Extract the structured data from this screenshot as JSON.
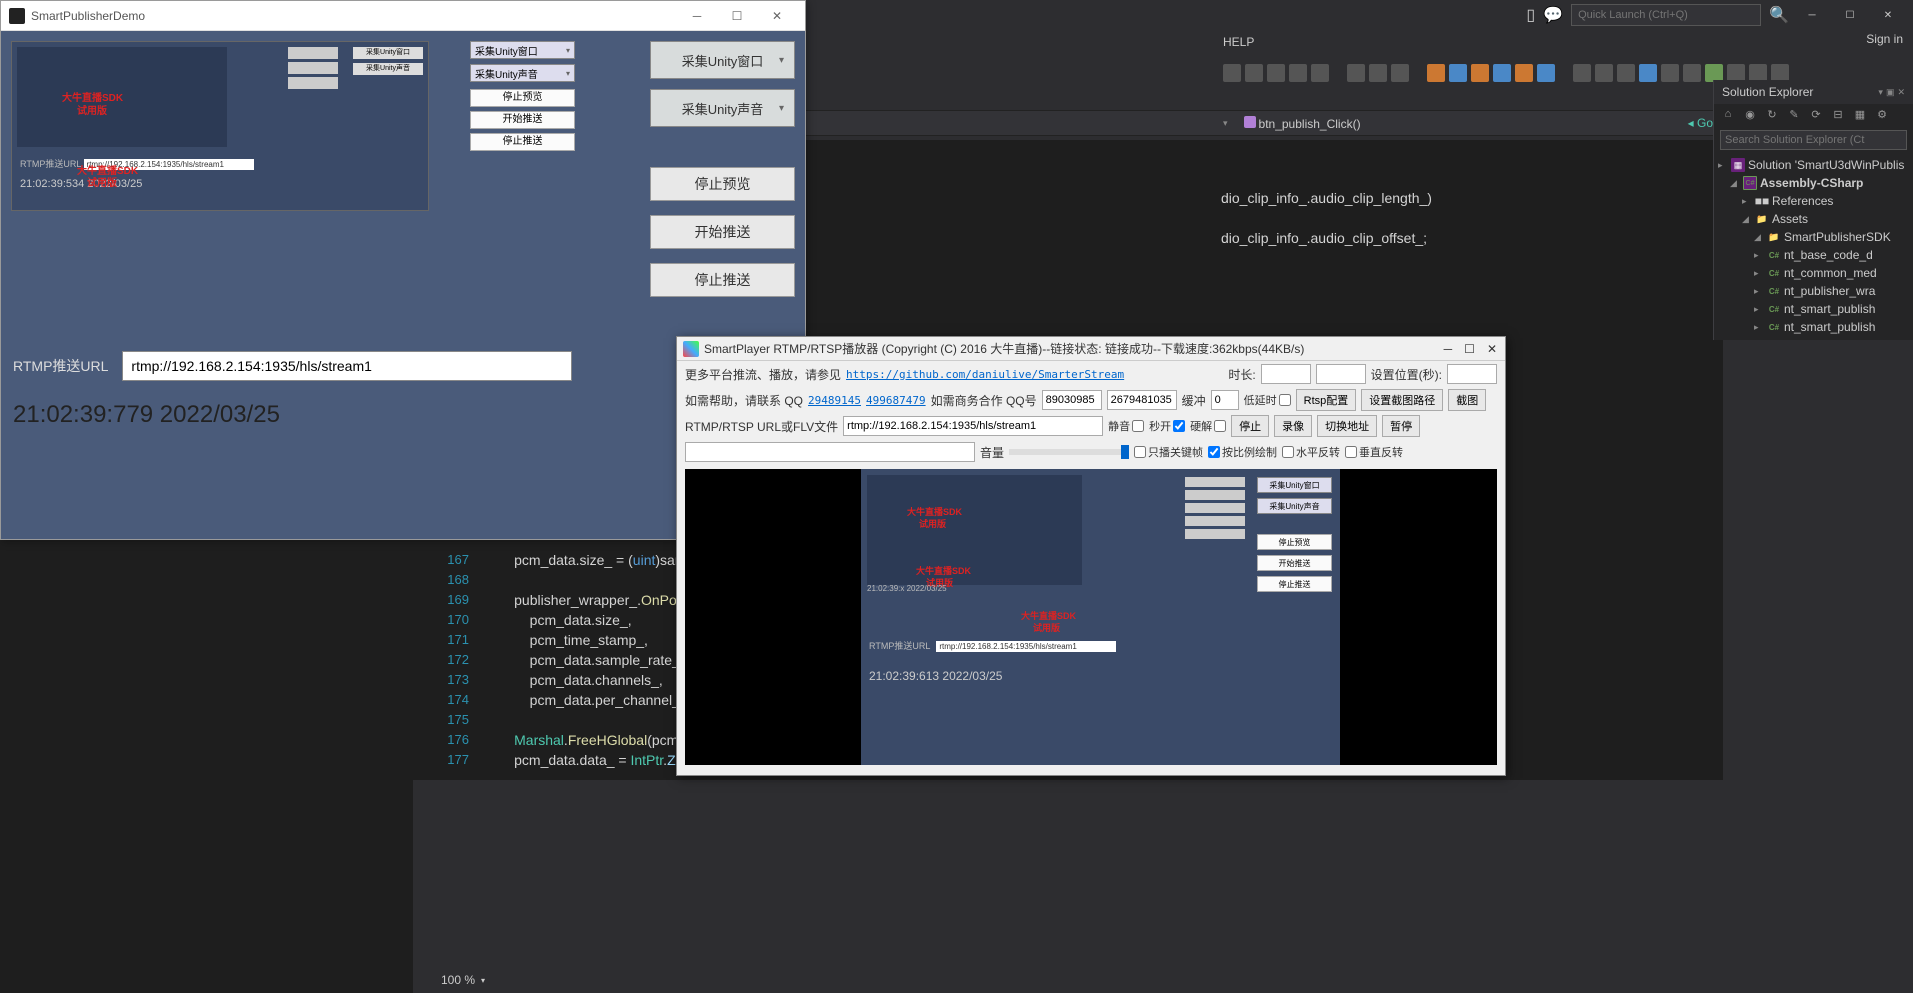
{
  "unity": {
    "title": "SmartPublisherDemo",
    "dropdowns": [
      "采集Unity窗口",
      "采集Unity声音"
    ],
    "mini_dropdowns": [
      "采集Unity窗口",
      "采集Unity声音"
    ],
    "mini_buttons": [
      "停止预览",
      "开始推送",
      "停止推送"
    ],
    "buttons": [
      "停止预览",
      "开始推送",
      "停止推送"
    ],
    "rtmp_label": "RTMP推送URL",
    "rtmp_value": "rtmp://192.168.2.154:1935/hls/stream1",
    "timestamp": "21:02:39:779 2022/03/25",
    "nested": {
      "watermark1": "大牛直播SDK",
      "watermark2": "试用版",
      "rtmp_label": "RTMP推送URL",
      "rtmp_value": "rtmp://192.168.2.154:1935/hls/stream1",
      "time": "21:02:39:534 2022/03/25",
      "side_dd": [
        "采集Unity窗口",
        "采集Unity声音"
      ],
      "side_btn": [
        "停止预览",
        "开始推送",
        "停止推送"
      ]
    }
  },
  "vs": {
    "search_placeholder": "Quick Launch (Ctrl+Q)",
    "menu": [
      "HELP"
    ],
    "signin": "Sign in",
    "nav_go": "Go",
    "nav_member": "btn_publish_Click()",
    "partial1": "dio_clip_info_.audio_clip_length_)",
    "partial2": "dio_clip_info_.audio_clip_offset_;",
    "zoom": "100 %",
    "code": [
      {
        "n": "167",
        "t": "        pcm_data.size_ = (uint)sample_length;"
      },
      {
        "n": "168",
        "t": ""
      },
      {
        "n": "169",
        "t": "        publisher_wrapper_.OnPostAudioPCMFloatData(pcm_data."
      },
      {
        "n": "170",
        "t": "            pcm_data.size_,"
      },
      {
        "n": "171",
        "t": "            pcm_time_stamp_,"
      },
      {
        "n": "172",
        "t": "            pcm_data.sample_rate_,"
      },
      {
        "n": "173",
        "t": "            pcm_data.channels_,"
      },
      {
        "n": "174",
        "t": "            pcm_data.per_channel_sample_number_);"
      },
      {
        "n": "175",
        "t": ""
      },
      {
        "n": "176",
        "t": "        Marshal.FreeHGlobal(pcm_data.data_);"
      },
      {
        "n": "177",
        "t": "        pcm_data.data_ = IntPtr.Zero;"
      }
    ]
  },
  "solution": {
    "header": "Solution Explorer",
    "search_placeholder": "Search Solution Explorer (Ct",
    "items": [
      {
        "label": "Solution 'SmartU3dWinPublis",
        "icon": "sln",
        "indent": 0,
        "chev": "▸"
      },
      {
        "label": "Assembly-CSharp",
        "icon": "proj",
        "indent": 1,
        "chev": "◢",
        "bold": true
      },
      {
        "label": "References",
        "icon": "ref",
        "indent": 2,
        "chev": "▸"
      },
      {
        "label": "Assets",
        "icon": "folder",
        "indent": 2,
        "chev": "◢"
      },
      {
        "label": "SmartPublisherSDK",
        "icon": "folder",
        "indent": 3,
        "chev": "◢"
      },
      {
        "label": "nt_base_code_d",
        "icon": "cs",
        "indent": 3,
        "chev": "▸"
      },
      {
        "label": "nt_common_med",
        "icon": "cs",
        "indent": 3,
        "chev": "▸"
      },
      {
        "label": "nt_publisher_wra",
        "icon": "cs",
        "indent": 3,
        "chev": "▸"
      },
      {
        "label": "nt_smart_publish",
        "icon": "cs",
        "indent": 3,
        "chev": "▸"
      },
      {
        "label": "nt_smart_publish",
        "icon": "cs",
        "indent": 3,
        "chev": "▸"
      }
    ]
  },
  "player": {
    "title": "SmartPlayer RTMP/RTSP播放器 (Copyright (C) 2016 大牛直播)--链接状态: 链接成功--下载速度:362kbps(44KB/s)",
    "row1_text": "更多平台推流、播放，请参见",
    "row1_link": "https://github.com/daniulive/SmarterStream",
    "row1_duration_label": "时长:",
    "row1_pos_label": "设置位置(秒):",
    "row2_help": "如需帮助，请联系 QQ",
    "row2_qq1": "29489145",
    "row2_qq2": "499687479",
    "row2_biz": "如需商务合作 QQ号",
    "row2_biz_qq1": "89030985",
    "row2_biz_qq2": "2679481035",
    "row2_buffer_label": "缓冲",
    "row2_buffer_val": "0",
    "row2_lowdelay": "低延时",
    "row2_rtsp_btn": "Rtsp配置",
    "row2_screenshot_btn": "设置截图路径",
    "row2_screenshot2": "截图",
    "row3_url_label": "RTMP/RTSP URL或FLV文件",
    "row3_url": "rtmp://192.168.2.154:1935/hls/stream1",
    "row3_mute": "静音",
    "row3_sec": "秒开",
    "row3_hw": "硬解",
    "row3_stop": "停止",
    "row3_record": "录像",
    "row3_switch": "切换地址",
    "row3_pause": "暂停",
    "row4_vol": "音量",
    "row4_keyframe": "只播关键帧",
    "row4_ratio": "按比例绘制",
    "row4_hflip": "水平反转",
    "row4_vflip": "垂直反转",
    "frame": {
      "watermark1": "大牛直播SDK",
      "watermark2": "试用版",
      "rtmp_label": "RTMP推送URL",
      "rtmp_value": "rtmp://192.168.2.154:1935/hls/stream1",
      "time": "21:02:39:613 2022/03/25",
      "dd": [
        "采集Unity窗口",
        "采集Unity声音"
      ],
      "btn": [
        "停止预览",
        "开始推送",
        "停止推送"
      ]
    }
  }
}
